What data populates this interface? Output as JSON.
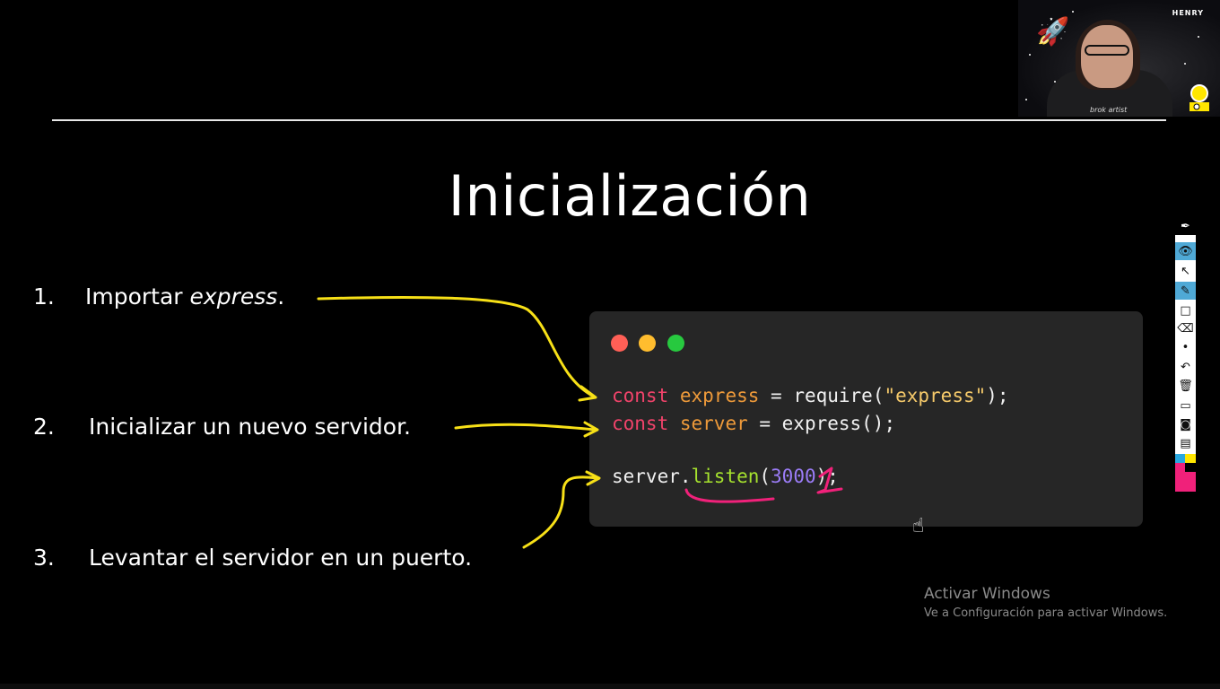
{
  "slide": {
    "title": "Inicialización",
    "steps": [
      {
        "num": "1.",
        "text_before": "Importar ",
        "text_em": "express",
        "text_after": "."
      },
      {
        "num": "2.",
        "text": "Inicializar un nuevo servidor."
      },
      {
        "num": "3.",
        "text": "Levantar el servidor en un puerto."
      }
    ],
    "code": {
      "line1": {
        "kw": "const",
        "var": "express",
        "rest1": " = require(",
        "str": "\"express\"",
        "rest2": ");"
      },
      "line2": {
        "kw": "const",
        "var": "server",
        "rest1": " = express();"
      },
      "line3": {
        "obj": "server",
        "dot": ".",
        "fn": "listen",
        "open": "(",
        "num": "3000",
        "close": ");"
      }
    },
    "window_dots": [
      "#ff5f56",
      "#ffbd2e",
      "#27c93f"
    ]
  },
  "webcam": {
    "brand": "HENRY",
    "shirt_text": "brok  artist"
  },
  "watermark": {
    "title": "Activar Windows",
    "subtitle": "Ve a Configuración para activar Windows."
  },
  "toolbar": {
    "tools": [
      "pen-icon",
      "eye-icon",
      "pointer-icon",
      "highlighter-icon",
      "rectangle-icon",
      "eraser-icon",
      "dot-icon",
      "undo-icon",
      "trash-icon",
      "monitor-icon",
      "camera-icon",
      "clipboard-icon"
    ],
    "colors": [
      "#29a8e0",
      "#ffe600",
      "#000000",
      "#f0217a"
    ]
  },
  "colors": {
    "arrow": "#f7e017",
    "annotation": "#f0217a"
  }
}
